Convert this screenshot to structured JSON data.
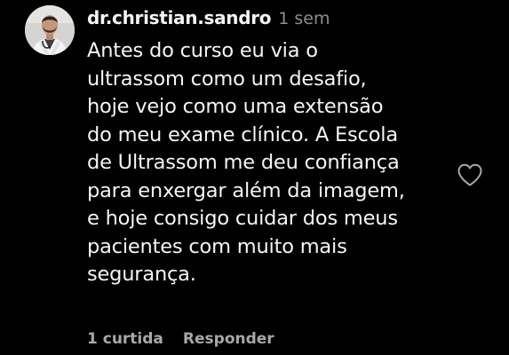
{
  "comment": {
    "username": "dr.christian.sandro",
    "timestamp": "1 sem",
    "text_lines": [
      "Antes do curso eu via o",
      "ultrassom como um desafio,",
      "hoje vejo como uma extensão",
      "do meu exame clínico. A Escola",
      "de Ultrassom me deu confiança",
      "para enxergar além da imagem,",
      "e hoje consigo cuidar dos meus",
      "pacientes com muito mais",
      "segurança."
    ],
    "likes_label": "1 curtida",
    "reply_label": "Responder",
    "like_icon": "heart-outline-icon",
    "avatar_icon": "user-avatar"
  },
  "colors": {
    "background": "#000000",
    "primary_text": "#f5f5f5",
    "secondary_text": "#a8a8a8",
    "timestamp_text": "#8e8e8e"
  }
}
